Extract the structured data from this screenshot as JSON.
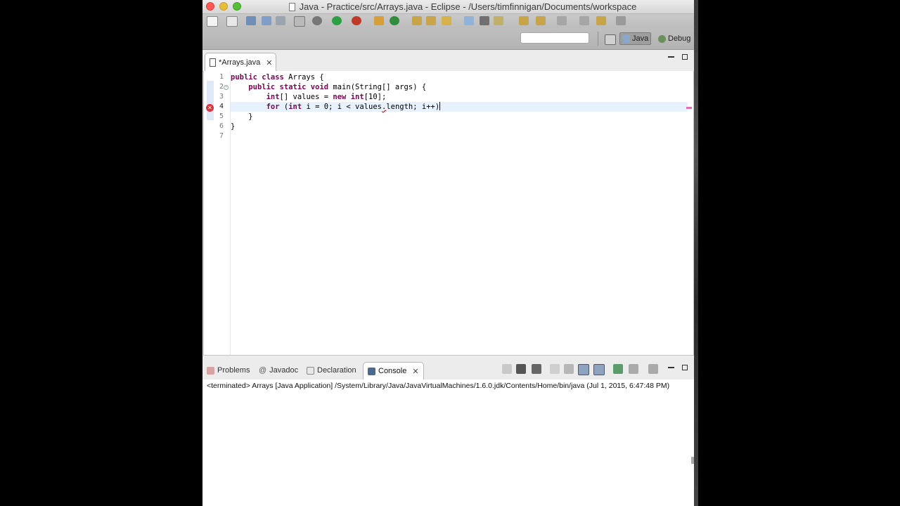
{
  "window": {
    "title": "Java - Practice/src/Arrays.java - Eclipse - /Users/timfinnigan/Documents/workspace"
  },
  "toolbar": {
    "quick_access_placeholder": "",
    "perspectives": [
      {
        "label": "Java",
        "active": true
      },
      {
        "label": "Debug",
        "active": false
      }
    ]
  },
  "editor": {
    "tab_label": "*Arrays.java",
    "lines": [
      {
        "number": "1",
        "text": "public class Arrays {"
      },
      {
        "number": "2",
        "text": "    public static void main(String[] args) {"
      },
      {
        "number": "3",
        "text": "        int[] values = new int[10];"
      },
      {
        "number": "4",
        "text": "        for (int i = 0; i < values.length; i++)"
      },
      {
        "number": "5",
        "text": "    }"
      },
      {
        "number": "6",
        "text": "}"
      },
      {
        "number": "7",
        "text": ""
      }
    ],
    "error_line": "4",
    "fold_line": "2"
  },
  "console": {
    "tabs": [
      {
        "label": "Problems",
        "active": false
      },
      {
        "label": "Javadoc",
        "active": false
      },
      {
        "label": "Declaration",
        "active": false
      },
      {
        "label": "Console",
        "active": true
      }
    ],
    "status_line": "<terminated> Arrays [Java Application] /System/Library/Java/JavaVirtualMachines/1.6.0.jdk/Contents/Home/bin/java (Jul 1, 2015, 6:47:48 PM)"
  },
  "colors": {
    "keyword": "#7f0055",
    "error": "#d9363e",
    "current_line": "#e8f2fe"
  }
}
